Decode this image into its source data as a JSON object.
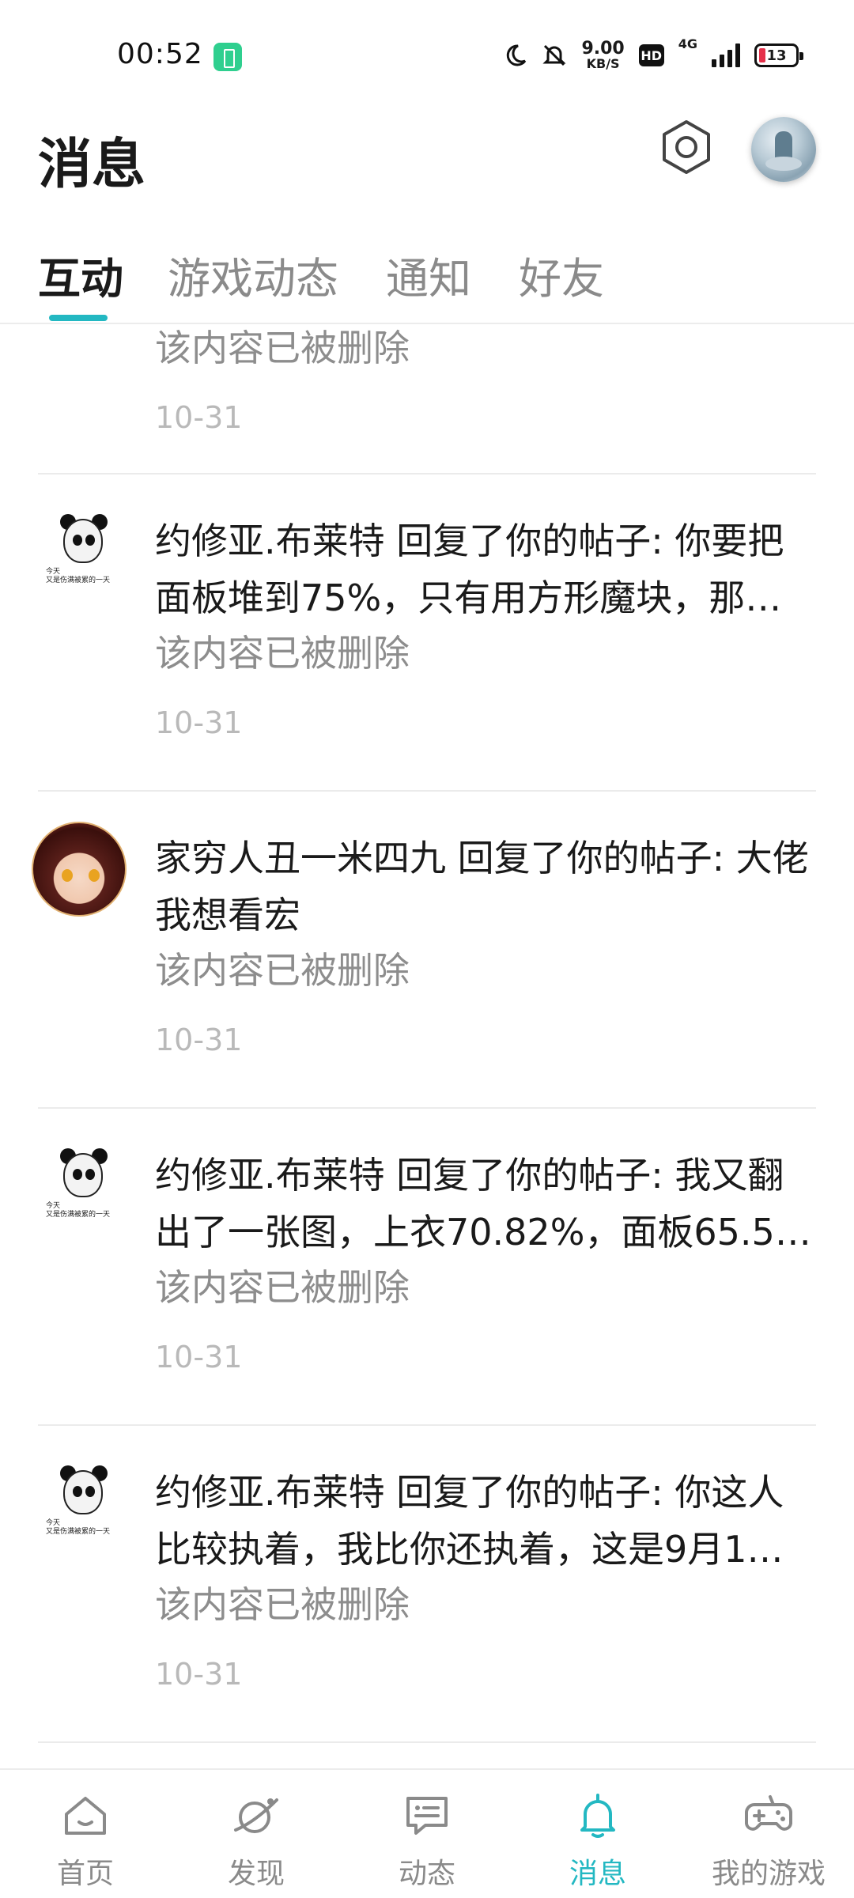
{
  "status_bar": {
    "time": "00:52",
    "speed_value": "9.00",
    "speed_unit": "KB/S",
    "hd_label": "HD",
    "network_label": "4G",
    "battery_level": "13"
  },
  "header": {
    "title": "消息"
  },
  "tabs": [
    {
      "label": "互动",
      "active": true
    },
    {
      "label": "游戏动态",
      "active": false
    },
    {
      "label": "通知",
      "active": false
    },
    {
      "label": "好友",
      "active": false
    }
  ],
  "messages": [
    {
      "avatar": "none",
      "text": "",
      "status": "该内容已被删除",
      "date": "10-31"
    },
    {
      "avatar": "panda-meme",
      "avatar_caption_1": "今天",
      "avatar_caption_2": "又是伤满被累的一天",
      "text": "约修亚.布莱特 回复了你的帖子: 你要把面板堆到75%，只有用方形魔块，那…",
      "status": "该内容已被删除",
      "date": "10-31"
    },
    {
      "avatar": "anime-girl",
      "text": "家穷人丑一米四九 回复了你的帖子: 大佬我想看宏",
      "status": "该内容已被删除",
      "date": "10-31"
    },
    {
      "avatar": "panda-meme",
      "avatar_caption_1": "今天",
      "avatar_caption_2": "又是伤满被累的一天",
      "text": "约修亚.布莱特 回复了你的帖子: 我又翻出了一张图，上衣70.82%，面板65.5…",
      "status": "该内容已被删除",
      "date": "10-31"
    },
    {
      "avatar": "panda-meme",
      "avatar_caption_1": "今天",
      "avatar_caption_2": "又是伤满被累的一天",
      "text": "约修亚.布莱特 回复了你的帖子: 你这人比较执着，我比你还执着，这是9月1…",
      "status": "该内容已被删除",
      "date": "10-31"
    }
  ],
  "bottom_nav": [
    {
      "label": "首页",
      "icon": "home-icon",
      "active": false
    },
    {
      "label": "发现",
      "icon": "planet-icon",
      "active": false
    },
    {
      "label": "动态",
      "icon": "feed-icon",
      "active": false
    },
    {
      "label": "消息",
      "icon": "bell-icon",
      "active": true
    },
    {
      "label": "我的游戏",
      "icon": "gamepad-icon",
      "active": false
    }
  ],
  "colors": {
    "accent": "#23b8c2",
    "inactive": "#8a8a8a",
    "deleted_text": "#8d8d8d",
    "date_text": "#b9b9b9"
  }
}
